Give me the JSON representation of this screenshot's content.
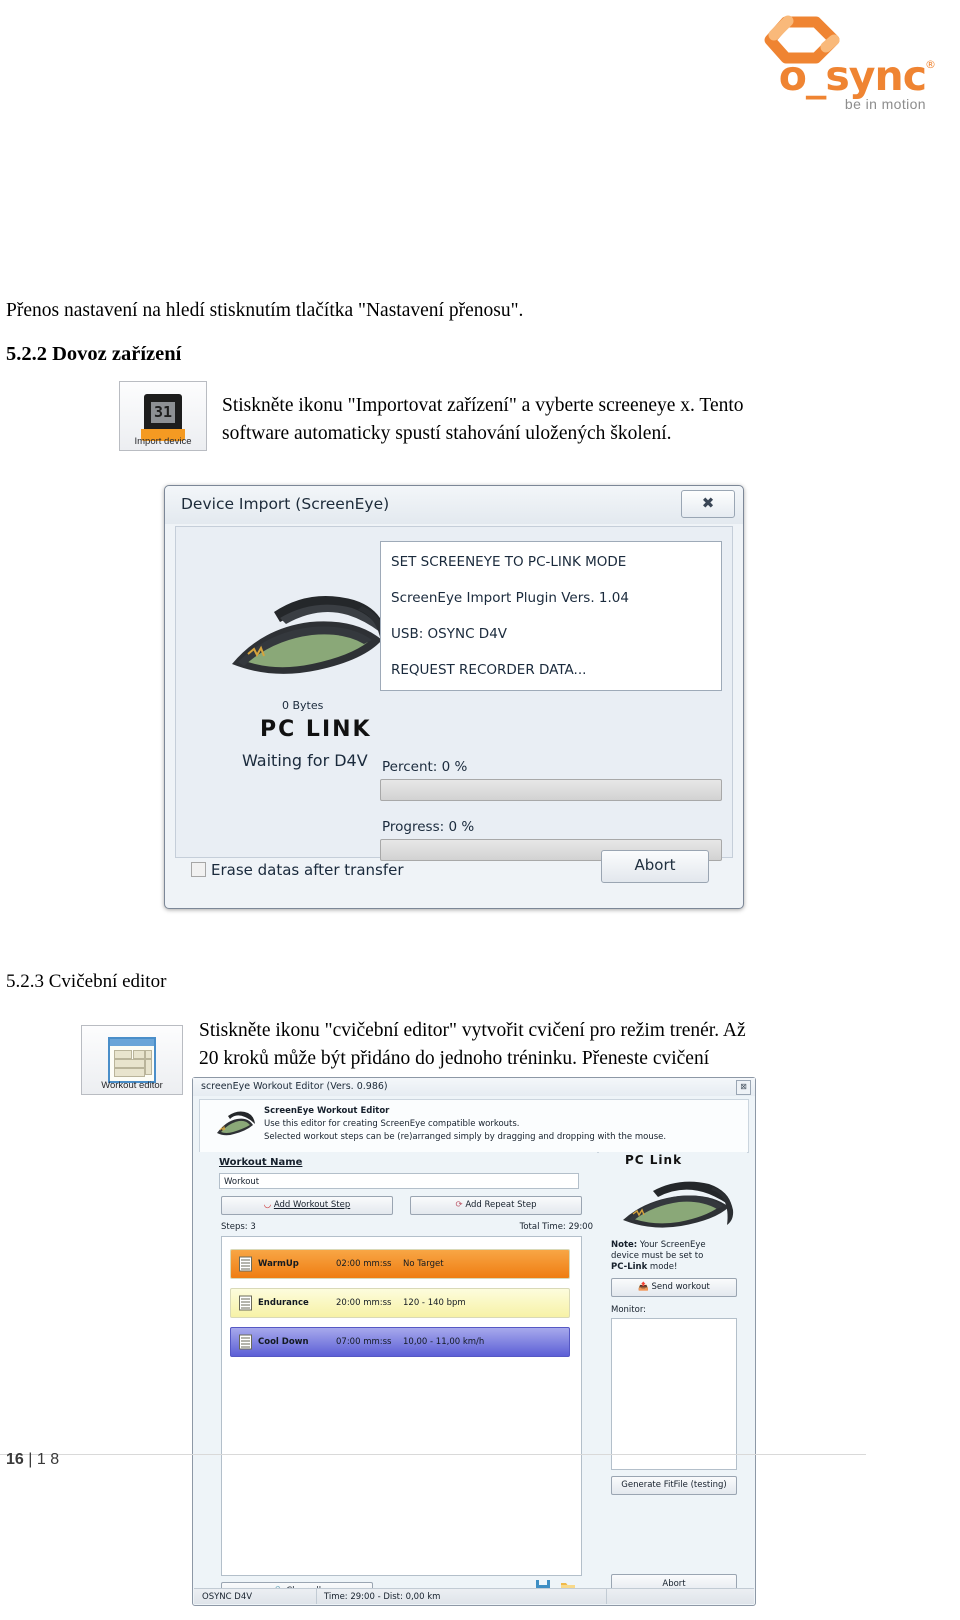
{
  "brand": {
    "wordmark": "o_sync",
    "registered": "®",
    "tagline": "be in motion",
    "accent": "#ef8432"
  },
  "document": {
    "intro_paragraph": "Přenos nastavení na hledí stisknutím tlačítka \"Nastavení přenosu\".",
    "section_522": {
      "heading": "5.2.2 Dovoz zařízení",
      "icon_caption": "Import device",
      "icon_name": "import-device-icon",
      "body_line1": "Stiskněte ikonu \"Importovat zařízení\" a vyberte screeneye x. Tento",
      "body_line2": "software automaticky spustí stahování uložených školení."
    },
    "section_523": {
      "heading": "5.2.3 Cvičební editor",
      "icon_caption": "Workout editor",
      "icon_name": "workout-editor-icon",
      "body_line1": "Stiskněte ikonu \"cvičební editor\" vytvořit cvičení pro režim trenér. Až",
      "body_line2": "20 kroků může být přidáno do jednoho tréninku. Přeneste cvičení"
    },
    "footer": {
      "page_current": "16",
      "separator": "|",
      "page_total": "1 8"
    }
  },
  "device_import_dialog": {
    "title": "Device Import (ScreenEye)",
    "close_glyph": "✖",
    "log_lines": [
      "SET SCREENEYE TO PC-LINK MODE",
      "ScreenEye Import Plugin Vers. 1.04",
      "USB: OSYNC D4V",
      "REQUEST RECORDER DATA..."
    ],
    "bytes_label": "0 Bytes",
    "pclink_label": "PC  LINK",
    "waiting_label": "Waiting for D4V",
    "percent_label": "Percent: 0 %",
    "percent_value": 0,
    "progress_label": "Progress: 0 %",
    "progress_value": 0,
    "erase_checkbox_label": "Erase datas after transfer",
    "erase_checked": false,
    "abort_label": "Abort"
  },
  "workout_editor": {
    "title": "screenEye Workout Editor (Vers. 0.986)",
    "close_glyph": "⊠",
    "header_title": "ScreenEye Workout Editor",
    "header_line1": "Use this editor for creating ScreenEye compatible workouts.",
    "header_line2": "Selected workout steps can be (re)arranged simply by dragging and dropping with the mouse.",
    "workout_name_label": "Workout Name",
    "workout_name_value": "Workout",
    "add_workout_step_label": "Add Workout Step",
    "add_repeat_step_label": "Add Repeat Step",
    "steps_label": "Steps: 3",
    "total_time_label": "Total Time: 29:00",
    "steps": [
      {
        "name": "WarmUp",
        "time": "02:00 mm:ss",
        "target": "No Target",
        "color_start": "#f8a645",
        "color_end": "#ef7d12"
      },
      {
        "name": "Endurance",
        "time": "20:00 mm:ss",
        "target": "120 - 140 bpm",
        "color_start": "#fdfcdd",
        "color_end": "#f7f2a6"
      },
      {
        "name": "Cool Down",
        "time": "07:00 mm:ss",
        "target": "10,00 - 11,00 km/h",
        "color_start": "#9a9ce8",
        "color_end": "#5c5fd6"
      }
    ],
    "clear_all_label": "Clear all",
    "save_icon_name": "save-icon",
    "open_icon_name": "folder-open-icon",
    "pclink_label": "PC  Link",
    "note_prefix": "Note:",
    "note_line1": " Your ScreenEye",
    "note_line2": "device must be set to",
    "note_bold2": "PC-Link",
    "note_line3": " mode!",
    "send_workout_label": "Send workout",
    "monitor_label": "Monitor:",
    "monitor_value": "",
    "generate_fitfile_label": "Generate FitFile (testing)",
    "abort_label": "Abort",
    "status_device": "OSYNC D4V",
    "status_summary": "Time: 29:00 - Dist: 0,00 km"
  }
}
